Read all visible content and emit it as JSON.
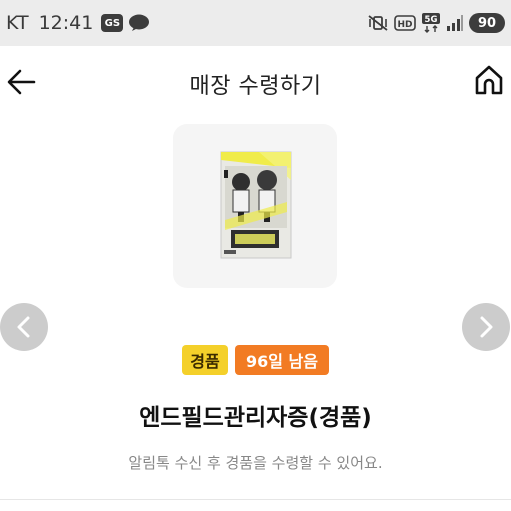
{
  "status_bar": {
    "carrier": "KT",
    "time": "12:41",
    "app_badge": "GS",
    "network": "5G",
    "hd_label": "HD",
    "battery": "90"
  },
  "header": {
    "title": "매장 수령하기"
  },
  "product": {
    "badge_gift": "경품",
    "badge_days": "96일 남음",
    "name": "엔드필드관리자증(경품)",
    "hint": "알림톡 수신 후 경품을 수령할 수 있어요."
  },
  "colors": {
    "gift_badge_bg": "#f4d02a",
    "days_badge_bg": "#f27b23",
    "status_bar_bg": "#ececec"
  },
  "icons": {
    "back": "arrow-left-icon",
    "home": "home-icon",
    "prev": "chevron-left-icon",
    "next": "chevron-right-icon"
  }
}
